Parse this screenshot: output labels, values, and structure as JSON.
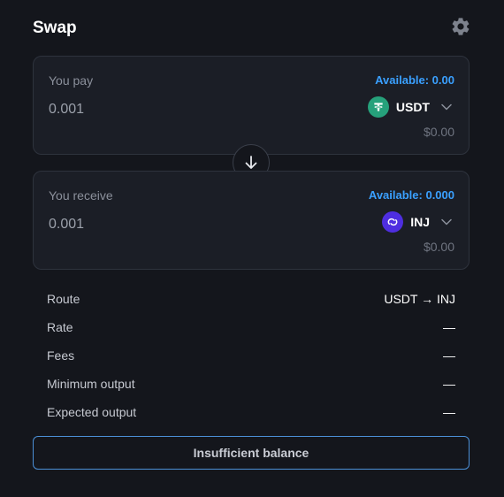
{
  "header": {
    "title": "Swap",
    "settings_icon": "gear-icon"
  },
  "pay": {
    "label": "You pay",
    "available": "Available: 0.00",
    "amount": "0.001",
    "token": {
      "symbol": "USDT",
      "icon": "tether-icon",
      "color": "#26a17b"
    },
    "usd_value": "$0.00"
  },
  "flip": {
    "icon": "arrow-down-icon"
  },
  "receive": {
    "label": "You receive",
    "available": "Available: 0.000",
    "amount": "0.001",
    "token": {
      "symbol": "INJ",
      "icon": "injective-icon",
      "color": "#4e2ee0"
    },
    "usd_value": "$0.00"
  },
  "details": [
    {
      "key": "Route",
      "value": "USDT → INJ"
    },
    {
      "key": "Rate",
      "value": "—"
    },
    {
      "key": "Fees",
      "value": "—"
    },
    {
      "key": "Minimum output",
      "value": "—"
    },
    {
      "key": "Expected output",
      "value": "—"
    }
  ],
  "cta": {
    "label": "Insufficient balance"
  },
  "colors": {
    "accent": "#3aa0ff",
    "cta_border": "#4b8fd6",
    "background": "#14161c",
    "card": "#1b1e26"
  }
}
